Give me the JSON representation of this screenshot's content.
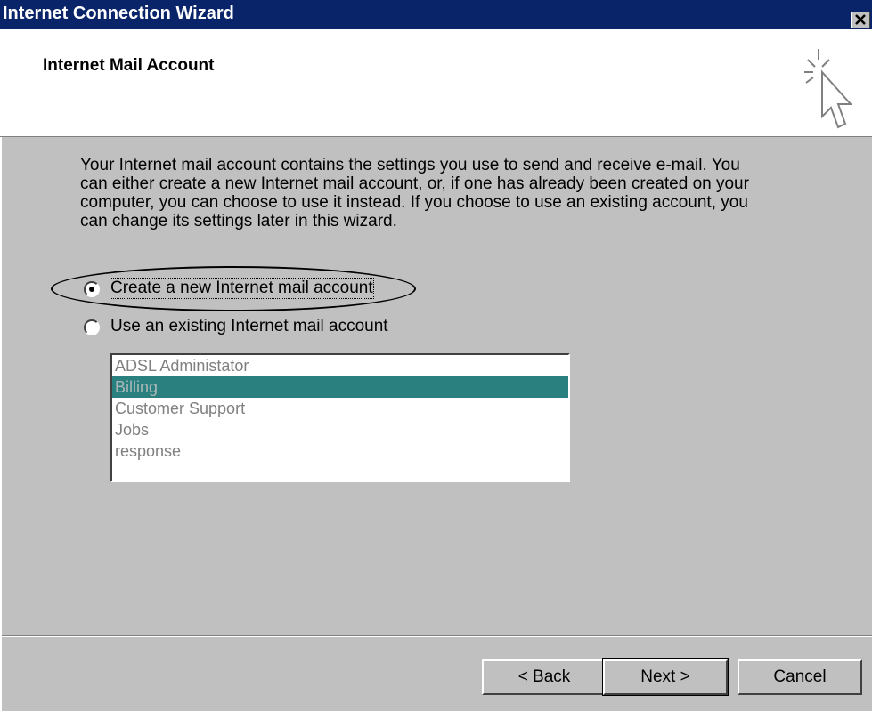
{
  "window": {
    "title": "Internet Connection Wizard",
    "close_label": "Close"
  },
  "header": {
    "title": "Internet Mail Account",
    "icon": "wizard-sparkle-cursor-icon"
  },
  "description": "Your Internet mail account contains the settings you use to send and receive e-mail. You can either create a new Internet mail account, or, if one has already been created on your computer, you can choose to use it instead. If you choose to use an existing account, you can change its settings later in this wizard.",
  "options": {
    "create_new": {
      "label": "Create a new Internet mail account",
      "selected": true
    },
    "use_existing": {
      "label": "Use an existing Internet mail account",
      "selected": false
    }
  },
  "accounts": {
    "items": [
      "ADSL Administator",
      "Billing",
      "Customer Support",
      "Jobs",
      "response"
    ],
    "selected_index": 1,
    "enabled": false
  },
  "buttons": {
    "back": "< Back",
    "next": "Next >",
    "cancel": "Cancel"
  },
  "colors": {
    "titlebar": "#0a246a",
    "selection": "#2a7f7f",
    "face": "#c0c0c0"
  }
}
